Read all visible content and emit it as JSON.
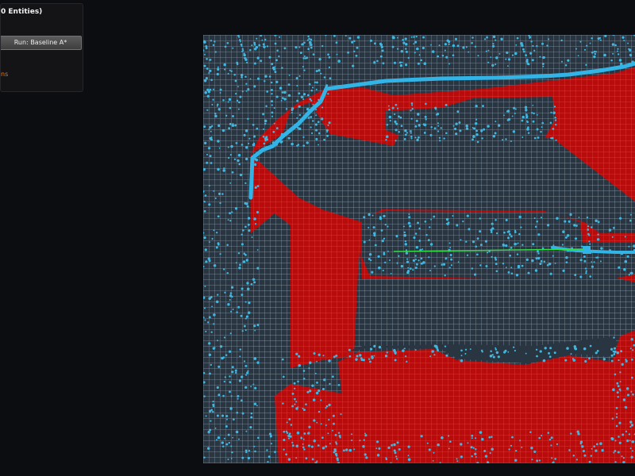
{
  "panel": {
    "title": "0 Entities)",
    "run_button_label": "Run: Baseline A*",
    "status_text": "ns"
  },
  "map": {
    "colors": {
      "background": "#0e1218",
      "free_cell": "#2a3542",
      "free_grid": "#8fa3b4",
      "obstacle_cell": "#b80c0c",
      "obstacle_grid": "#e23a3a",
      "explored_point": "#3fb7e0",
      "frontier_path": "#32b4e6",
      "planned_path": "#33dd44"
    }
  }
}
